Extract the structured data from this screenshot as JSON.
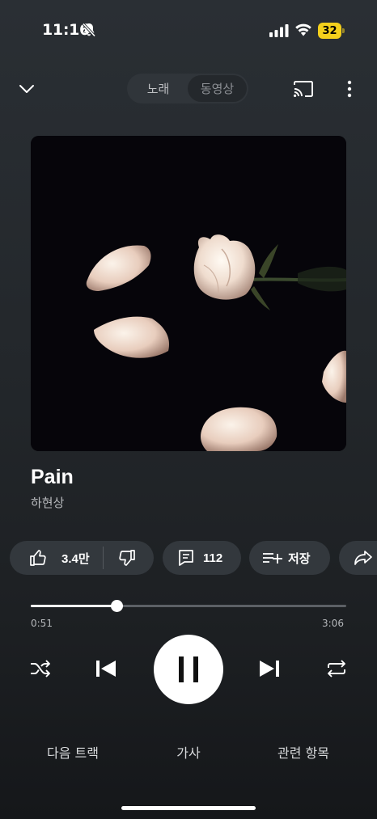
{
  "status_bar": {
    "time": "11:16",
    "battery": "32"
  },
  "top": {
    "tabs": [
      {
        "label": "노래"
      },
      {
        "label": "동영상"
      }
    ]
  },
  "track": {
    "title": "Pain",
    "artist": "하현상"
  },
  "actions": {
    "likes": "3.4만",
    "comments": "112",
    "save_label": "저장"
  },
  "progress": {
    "current": "0:51",
    "duration": "3:06",
    "fraction": 0.274
  },
  "bottom_tabs": [
    {
      "label": "다음 트랙"
    },
    {
      "label": "가사"
    },
    {
      "label": "관련 항목"
    }
  ],
  "colors": {
    "accent_battery": "#f4d01c",
    "background": "#23272b"
  }
}
